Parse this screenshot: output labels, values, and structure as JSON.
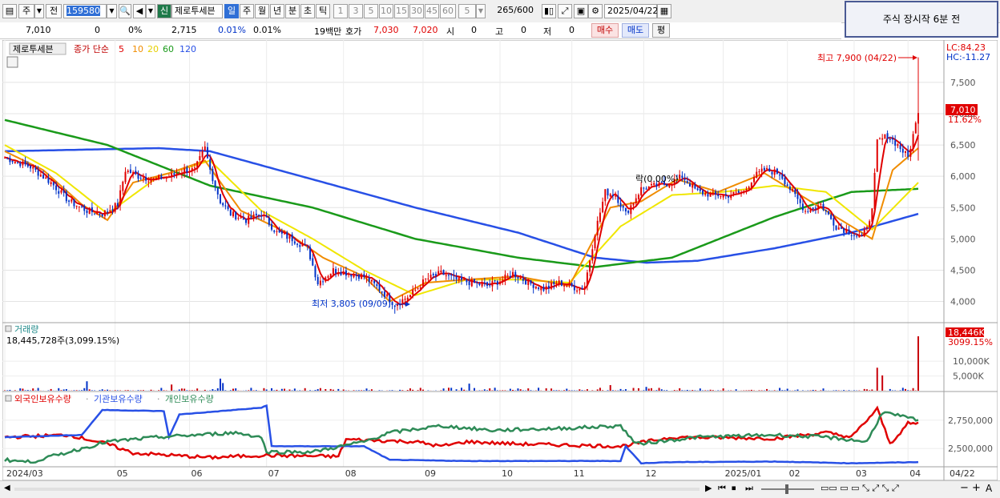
{
  "toolbar": {
    "market": "주",
    "prev": "전",
    "code": "159580",
    "new_label": "신",
    "stock_name": "제로투세븐",
    "periods": [
      "일",
      "주",
      "월",
      "년",
      "분",
      "초",
      "틱"
    ],
    "active_period": "일",
    "numbers": [
      "1",
      "3",
      "5",
      "10",
      "15",
      "30",
      "45",
      "60"
    ],
    "interval": "5",
    "count": "265",
    "count_max": "/600",
    "date": "2025/04/22",
    "even_btn": "평"
  },
  "notice": "주식 장시작   6분 전",
  "quote": {
    "price": "7,010",
    "change": "0",
    "change_pct": "0%",
    "volume": "2,715",
    "vol_pct": "0.01%",
    "vol_pct2": "0.01%",
    "unit": "19백만",
    "ask_label": "호가",
    "ask": "7,030",
    "bid": "7,020",
    "open_label": "시",
    "open": "0",
    "high_label": "고",
    "high": "0",
    "low_label": "저",
    "low": "0",
    "buy": "매수",
    "sell": "매도",
    "even": "평"
  },
  "colors": {
    "up": "#e00000",
    "down": "#0032c8",
    "ma5": "#e00000",
    "ma10": "#f08c00",
    "ma20": "#f0e600",
    "ma60": "#1a9a1a",
    "ma120": "#2850e6",
    "foreign": "#e00000",
    "inst": "#2850e6",
    "indiv": "#2e8b57",
    "vol_bar": "#c8000a"
  },
  "chart_data": [
    {
      "type": "candlestick",
      "legend": {
        "name": "제로투세븐",
        "label": "종가 단순",
        "periods": [
          "5",
          "10",
          "20",
          "60",
          "120"
        ]
      },
      "y_ticks": [
        "7,500",
        "7,000",
        "6,500",
        "6,000",
        "5,500",
        "5,000",
        "4,500",
        "4,000"
      ],
      "y_tick_values": [
        7500,
        7000,
        6500,
        6000,
        5500,
        5000,
        4500,
        4000
      ],
      "ylim": [
        3700,
        8100
      ],
      "series": {
        "close_anchors": [
          [
            0,
            6300
          ],
          [
            10,
            6150
          ],
          [
            18,
            5900
          ],
          [
            25,
            5600
          ],
          [
            32,
            5450
          ],
          [
            38,
            5400
          ],
          [
            44,
            5550
          ],
          [
            47,
            6100
          ],
          [
            52,
            6000
          ],
          [
            58,
            5950
          ],
          [
            64,
            6000
          ],
          [
            70,
            6100
          ],
          [
            74,
            6100
          ],
          [
            78,
            6450
          ],
          [
            80,
            6100
          ],
          [
            84,
            5600
          ],
          [
            88,
            5400
          ],
          [
            94,
            5300
          ],
          [
            100,
            5400
          ],
          [
            106,
            5100
          ],
          [
            112,
            5000
          ],
          [
            118,
            4850
          ],
          [
            122,
            4300
          ],
          [
            128,
            4500
          ],
          [
            134,
            4450
          ],
          [
            140,
            4400
          ],
          [
            146,
            4200
          ],
          [
            152,
            3950
          ],
          [
            158,
            4100
          ],
          [
            164,
            4350
          ],
          [
            170,
            4450
          ],
          [
            176,
            4350
          ],
          [
            182,
            4300
          ],
          [
            188,
            4250
          ],
          [
            194,
            4350
          ],
          [
            198,
            4450
          ],
          [
            204,
            4300
          ],
          [
            210,
            4200
          ],
          [
            216,
            4300
          ],
          [
            220,
            4250
          ],
          [
            224,
            4200
          ],
          [
            226,
            4250
          ],
          [
            230,
            5100
          ],
          [
            234,
            5750
          ],
          [
            238,
            5700
          ],
          [
            242,
            5400
          ],
          [
            248,
            5800
          ],
          [
            254,
            5850
          ],
          [
            260,
            5900
          ],
          [
            264,
            6000
          ],
          [
            270,
            5750
          ],
          [
            276,
            5700
          ],
          [
            282,
            5700
          ],
          [
            288,
            5750
          ],
          [
            292,
            6000
          ],
          [
            296,
            6100
          ],
          [
            302,
            6050
          ],
          [
            306,
            5800
          ],
          [
            312,
            5450
          ],
          [
            318,
            5550
          ],
          [
            324,
            5200
          ],
          [
            330,
            5100
          ],
          [
            334,
            5000
          ],
          [
            338,
            5450
          ],
          [
            340,
            6550
          ],
          [
            344,
            6650
          ],
          [
            348,
            6500
          ],
          [
            352,
            6300
          ],
          [
            356,
            7010
          ]
        ],
        "ma60_anchors": [
          [
            0,
            6900
          ],
          [
            40,
            6500
          ],
          [
            80,
            5850
          ],
          [
            120,
            5500
          ],
          [
            160,
            5000
          ],
          [
            200,
            4700
          ],
          [
            230,
            4550
          ],
          [
            260,
            4700
          ],
          [
            300,
            5350
          ],
          [
            330,
            5750
          ],
          [
            356,
            5800
          ]
        ],
        "ma120_anchors": [
          [
            0,
            6400
          ],
          [
            60,
            6450
          ],
          [
            80,
            6400
          ],
          [
            120,
            5950
          ],
          [
            160,
            5500
          ],
          [
            200,
            5100
          ],
          [
            230,
            4700
          ],
          [
            250,
            4620
          ],
          [
            270,
            4650
          ],
          [
            300,
            4850
          ],
          [
            330,
            5100
          ],
          [
            356,
            5400
          ]
        ],
        "ma20_anchors": [
          [
            0,
            6500
          ],
          [
            20,
            6050
          ],
          [
            40,
            5400
          ],
          [
            60,
            6000
          ],
          [
            80,
            6250
          ],
          [
            100,
            5450
          ],
          [
            120,
            5000
          ],
          [
            140,
            4500
          ],
          [
            160,
            4100
          ],
          [
            180,
            4350
          ],
          [
            200,
            4350
          ],
          [
            220,
            4300
          ],
          [
            240,
            5200
          ],
          [
            260,
            5700
          ],
          [
            280,
            5750
          ],
          [
            300,
            5850
          ],
          [
            320,
            5750
          ],
          [
            338,
            5150
          ],
          [
            356,
            5900
          ]
        ],
        "ma10_anchors": [
          [
            0,
            6400
          ],
          [
            15,
            6100
          ],
          [
            30,
            5550
          ],
          [
            40,
            5300
          ],
          [
            50,
            5900
          ],
          [
            64,
            6050
          ],
          [
            78,
            6250
          ],
          [
            92,
            5450
          ],
          [
            110,
            5100
          ],
          [
            124,
            4700
          ],
          [
            140,
            4400
          ],
          [
            150,
            4000
          ],
          [
            164,
            4300
          ],
          [
            180,
            4350
          ],
          [
            200,
            4400
          ],
          [
            220,
            4250
          ],
          [
            236,
            5500
          ],
          [
            248,
            5600
          ],
          [
            262,
            5950
          ],
          [
            278,
            5750
          ],
          [
            296,
            6050
          ],
          [
            312,
            5650
          ],
          [
            326,
            5300
          ],
          [
            338,
            5000
          ],
          [
            346,
            6100
          ],
          [
            356,
            6450
          ]
        ],
        "highlight": {
          "high_label": "최고 7,900 (04/22)",
          "high": 7900,
          "low_label": "최저 3,805 (09/09)",
          "low": 3805,
          "last_price": "7,010",
          "last_pct": "11.62%",
          "lc": "LC:84.23",
          "hc": "HC:-11.27",
          "event": "락(0.00%)"
        }
      }
    },
    {
      "type": "bar",
      "title": "거래량",
      "summary": "18,445,728주(3,099.15%)",
      "y_ticks": [
        "10,000K",
        "5,000K"
      ],
      "y_tick_values": [
        10000,
        5000
      ],
      "ylim": [
        0,
        19000
      ],
      "last_value": "18,446K",
      "last_pct": "3099.15%",
      "spikes": [
        [
          32,
          3200
        ],
        [
          65,
          2100
        ],
        [
          84,
          4100
        ],
        [
          85,
          2600
        ],
        [
          181,
          2400
        ],
        [
          236,
          1900
        ],
        [
          250,
          1300
        ],
        [
          340,
          7800
        ],
        [
          342,
          5200
        ],
        [
          356,
          18446
        ]
      ]
    },
    {
      "type": "line",
      "legend": [
        "외국인보유수량",
        "기관보유수량",
        "개인보유수량"
      ],
      "y_ticks": [
        "2,750,000",
        "2,500,000"
      ],
      "y_tick_values": [
        2750000,
        2500000
      ],
      "ylim": [
        2360000,
        2890000
      ]
    }
  ],
  "x_axis": {
    "labels": [
      "2024/03",
      "05",
      "06",
      "07",
      "08",
      "09",
      "10",
      "11",
      "12",
      "2025/01",
      "02",
      "03",
      "04"
    ],
    "last": "04/22"
  },
  "bottom": {
    "left_arrow": "◀",
    "controls": [
      "▶",
      "⏮",
      "⏹",
      "⏭"
    ],
    "symbols": [
      "−",
      "+",
      "A"
    ]
  }
}
